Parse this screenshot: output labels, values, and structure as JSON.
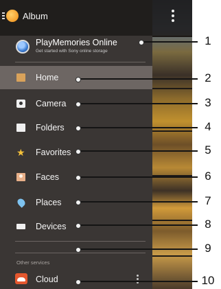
{
  "header": {
    "title": "Album"
  },
  "account": {
    "title": "PlayMemories Online",
    "subtitle": "Get started with Sony online storage"
  },
  "menu": {
    "items": [
      {
        "label": "Home",
        "icon": "home-icon",
        "active": true
      },
      {
        "label": "Camera",
        "icon": "camera-icon"
      },
      {
        "label": "Folders",
        "icon": "folder-icon"
      },
      {
        "label": "Favorites",
        "icon": "star-icon"
      },
      {
        "label": "Faces",
        "icon": "faces-icon"
      },
      {
        "label": "Places",
        "icon": "location-pin-icon"
      },
      {
        "label": "Devices",
        "icon": "devices-icon"
      }
    ]
  },
  "other_services": {
    "heading": "Other services",
    "cloud_label": "Cloud",
    "cloud_icon": "cloud-icon"
  },
  "callouts": [
    "1",
    "2",
    "3",
    "4",
    "5",
    "6",
    "7",
    "8",
    "9",
    "10"
  ],
  "colors": {
    "drawer_bg": "#3a3634",
    "active_bg": "#6d6663",
    "accent_orange": "#f08a12"
  }
}
